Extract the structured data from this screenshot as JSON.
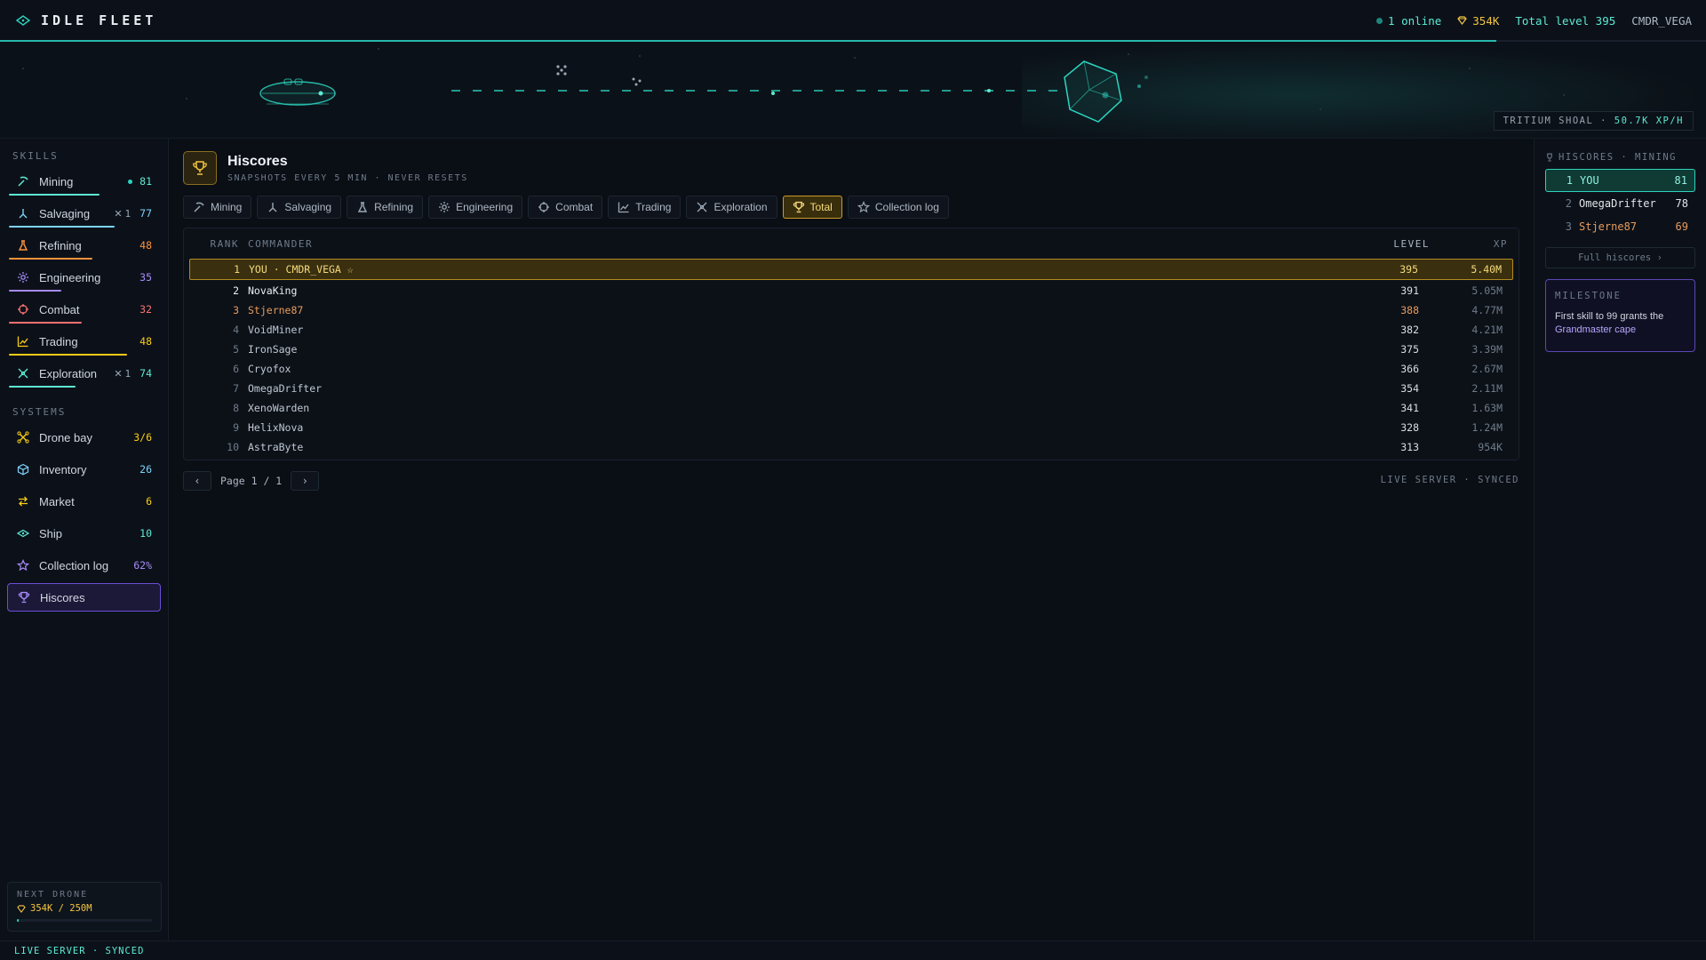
{
  "app": {
    "name": "IDLE FLEET"
  },
  "status": {
    "online": "1 online",
    "credits": "354K",
    "total_level": "Total level 395",
    "user": "CMDR_VEGA",
    "xp_progress": 0.877
  },
  "banner": {
    "location": "TRITIUM SHOAL",
    "separator": "·",
    "xp_rate": "50.7K XP/H"
  },
  "sidebar": {
    "skills_label": "SKILLS",
    "skills": [
      {
        "name": "Mining",
        "level": "81",
        "color": "#5eead4",
        "icon": "pickaxe-icon",
        "active": true,
        "progress": 0.6
      },
      {
        "name": "Salvaging",
        "level": "77",
        "color": "#7dd3fc",
        "icon": "salvage-claw-icon",
        "drones": "1",
        "progress": 0.7
      },
      {
        "name": "Refining",
        "level": "48",
        "color": "#fb923c",
        "icon": "flask-icon",
        "progress": 0.55
      },
      {
        "name": "Engineering",
        "level": "35",
        "color": "#a78bfa",
        "icon": "gear-icon",
        "progress": 0.35
      },
      {
        "name": "Combat",
        "level": "32",
        "color": "#f87171",
        "icon": "crosshair-icon",
        "progress": 0.48
      },
      {
        "name": "Trading",
        "level": "48",
        "color": "#facc15",
        "icon": "chart-icon",
        "progress": 0.78
      },
      {
        "name": "Exploration",
        "level": "74",
        "color": "#5eead4",
        "icon": "satellite-icon",
        "drones": "1",
        "progress": 0.44
      }
    ],
    "systems_label": "SYSTEMS",
    "systems": [
      {
        "name": "Drone bay",
        "count": "3/6",
        "color": "#facc15",
        "icon": "drone-icon"
      },
      {
        "name": "Inventory",
        "count": "26",
        "color": "#7dd3fc",
        "icon": "cube-icon"
      },
      {
        "name": "Market",
        "count": "6",
        "color": "#facc15",
        "icon": "swap-icon"
      },
      {
        "name": "Ship",
        "count": "10",
        "color": "#5eead4",
        "icon": "ship-icon"
      },
      {
        "name": "Collection log",
        "count": "62%",
        "color": "#a78bfa",
        "icon": "star-icon"
      },
      {
        "name": "Hiscores",
        "count": "",
        "color": "#a78bfa",
        "icon": "trophy-icon",
        "active": true
      }
    ],
    "next_drone": {
      "label": "NEXT DRONE",
      "value": "354K / 250M",
      "progress": 0.0014
    }
  },
  "main": {
    "title": "Hiscores",
    "subtitle": "SNAPSHOTS EVERY 5 MIN · NEVER RESETS",
    "tabs": [
      {
        "label": "Mining",
        "icon": "pickaxe-icon"
      },
      {
        "label": "Salvaging",
        "icon": "salvage-claw-icon"
      },
      {
        "label": "Refining",
        "icon": "flask-icon"
      },
      {
        "label": "Engineering",
        "icon": "gear-icon"
      },
      {
        "label": "Combat",
        "icon": "crosshair-icon"
      },
      {
        "label": "Trading",
        "icon": "chart-icon"
      },
      {
        "label": "Exploration",
        "icon": "satellite-icon"
      },
      {
        "label": "Total",
        "icon": "trophy-icon",
        "active": true
      },
      {
        "label": "Collection log",
        "icon": "star-icon"
      }
    ],
    "table": {
      "headers": {
        "rank": "RANK",
        "commander": "COMMANDER",
        "level": "LEVEL",
        "xp": "XP"
      },
      "rows": [
        {
          "rank": "1",
          "commander": "YOU · CMDR_VEGA ☆",
          "level": "395",
          "xp": "5.40M",
          "you": true
        },
        {
          "rank": "2",
          "commander": "NovaKing",
          "level": "391",
          "xp": "5.05M",
          "tier": "top"
        },
        {
          "rank": "3",
          "commander": "Stjerne87",
          "level": "388",
          "xp": "4.77M",
          "tier": "bronze"
        },
        {
          "rank": "4",
          "commander": "VoidMiner",
          "level": "382",
          "xp": "4.21M"
        },
        {
          "rank": "5",
          "commander": "IronSage",
          "level": "375",
          "xp": "3.39M"
        },
        {
          "rank": "6",
          "commander": "Cryofox",
          "level": "366",
          "xp": "2.67M"
        },
        {
          "rank": "7",
          "commander": "OmegaDrifter",
          "level": "354",
          "xp": "2.11M"
        },
        {
          "rank": "8",
          "commander": "XenoWarden",
          "level": "341",
          "xp": "1.63M"
        },
        {
          "rank": "9",
          "commander": "HelixNova",
          "level": "328",
          "xp": "1.24M"
        },
        {
          "rank": "10",
          "commander": "AstraByte",
          "level": "313",
          "xp": "954K"
        }
      ]
    },
    "pager": {
      "prev": "‹",
      "next": "›",
      "text": "Page 1 / 1"
    },
    "server_status": "LIVE SERVER · SYNCED"
  },
  "right_panel": {
    "label": "HISCORES · MINING",
    "rows": [
      {
        "rank": "1",
        "name": "YOU",
        "level": "81",
        "you": true
      },
      {
        "rank": "2",
        "name": "OmegaDrifter",
        "level": "78"
      },
      {
        "rank": "3",
        "name": "Stjerne87",
        "level": "69",
        "tier": "bronze"
      }
    ],
    "full_button": "Full hiscores ›",
    "milestone": {
      "label": "MILESTONE",
      "text": "First skill to 99 grants the",
      "highlight": "Grandmaster cape"
    }
  },
  "footer": {
    "status": "LIVE SERVER · SYNCED"
  }
}
